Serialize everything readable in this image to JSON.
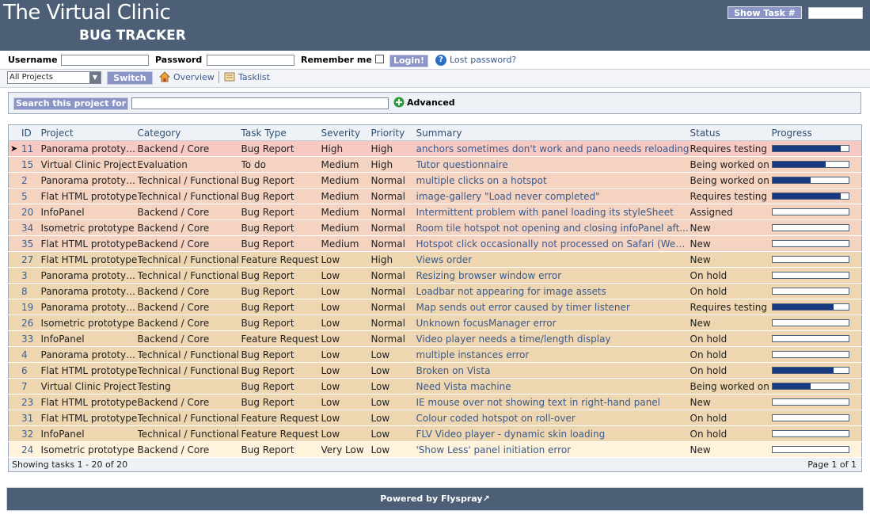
{
  "header": {
    "title": "The Virtual Clinic",
    "subtitle": "BUG TRACKER",
    "show_task_label": "Show Task #"
  },
  "login": {
    "username_label": "Username",
    "password_label": "Password",
    "remember_label": "Remember me",
    "login_button": "Login!",
    "lost_password": "Lost password?"
  },
  "nav": {
    "project_selected": "All Projects",
    "switch_button": "Switch",
    "overview": "Overview",
    "tasklist": "Tasklist"
  },
  "search": {
    "button": "Search this project for",
    "advanced": "Advanced"
  },
  "table": {
    "columns": [
      "ID",
      "Project",
      "Category",
      "Task Type",
      "Severity",
      "Priority",
      "Summary",
      "Status",
      "Progress"
    ],
    "rows": [
      {
        "id": "11",
        "project": "Panorama prototype",
        "category": "Backend / Core",
        "type": "Bug Report",
        "severity": "High",
        "priority": "High",
        "summary": "anchors sometimes don't work and pano needs reloading",
        "status": "Requires testing",
        "progress": 0.9,
        "sev_class": "high",
        "selected": true
      },
      {
        "id": "15",
        "project": "Virtual Clinic Project",
        "category": "Evaluation",
        "type": "To do",
        "severity": "Medium",
        "priority": "High",
        "summary": "Tutor questionnaire",
        "status": "Being worked on",
        "progress": 0.7,
        "sev_class": "medium"
      },
      {
        "id": "2",
        "project": "Panorama prototype",
        "category": "Technical / Functional",
        "type": "Bug Report",
        "severity": "Medium",
        "priority": "Normal",
        "summary": "multiple clicks on a hotspot",
        "status": "Being worked on",
        "progress": 0.5,
        "sev_class": "medium"
      },
      {
        "id": "5",
        "project": "Flat HTML prototype",
        "category": "Technical / Functional",
        "type": "Bug Report",
        "severity": "Medium",
        "priority": "Normal",
        "summary": "image-gallery \"Load never completed\"",
        "status": "Requires testing",
        "progress": 0.9,
        "sev_class": "medium"
      },
      {
        "id": "20",
        "project": "InfoPanel",
        "category": "Backend / Core",
        "type": "Bug Report",
        "severity": "Medium",
        "priority": "Normal",
        "summary": "Intermittent problem with panel loading its styleSheet",
        "status": "Assigned",
        "progress": 0,
        "sev_class": "medium"
      },
      {
        "id": "34",
        "project": "Isometric prototype",
        "category": "Backend / Core",
        "type": "Bug Report",
        "severity": "Medium",
        "priority": "Normal",
        "summary": "Room tile hotspot not opening and closing infoPanel aft...",
        "status": "New",
        "progress": 0,
        "sev_class": "medium"
      },
      {
        "id": "35",
        "project": "Flat HTML prototype",
        "category": "Backend / Core",
        "type": "Bug Report",
        "severity": "Medium",
        "priority": "Normal",
        "summary": "Hotspot click occasionally not processed on Safari (Web...",
        "status": "New",
        "progress": 0,
        "sev_class": "medium"
      },
      {
        "id": "27",
        "project": "Flat HTML prototype",
        "category": "Technical / Functional",
        "type": "Feature Request",
        "severity": "Low",
        "priority": "High",
        "summary": "Views order",
        "status": "New",
        "progress": 0,
        "sev_class": "low"
      },
      {
        "id": "3",
        "project": "Panorama prototype",
        "category": "Technical / Functional",
        "type": "Bug Report",
        "severity": "Low",
        "priority": "Normal",
        "summary": "Resizing browser window error",
        "status": "On hold",
        "progress": 0,
        "sev_class": "low"
      },
      {
        "id": "8",
        "project": "Panorama prototype",
        "category": "Backend / Core",
        "type": "Bug Report",
        "severity": "Low",
        "priority": "Normal",
        "summary": "Loadbar not appearing for image assets",
        "status": "On hold",
        "progress": 0,
        "sev_class": "low"
      },
      {
        "id": "19",
        "project": "Panorama prototype",
        "category": "Backend / Core",
        "type": "Bug Report",
        "severity": "Low",
        "priority": "Normal",
        "summary": "Map sends out error caused by timer listener",
        "status": "Requires testing",
        "progress": 0.8,
        "sev_class": "low"
      },
      {
        "id": "26",
        "project": "Isometric prototype",
        "category": "Backend / Core",
        "type": "Bug Report",
        "severity": "Low",
        "priority": "Normal",
        "summary": "Unknown focusManager error",
        "status": "New",
        "progress": 0,
        "sev_class": "low"
      },
      {
        "id": "33",
        "project": "InfoPanel",
        "category": "Backend / Core",
        "type": "Feature Request",
        "severity": "Low",
        "priority": "Normal",
        "summary": "Video player needs a time/length display",
        "status": "On hold",
        "progress": 0,
        "sev_class": "low"
      },
      {
        "id": "4",
        "project": "Panorama prototype",
        "category": "Technical / Functional",
        "type": "Bug Report",
        "severity": "Low",
        "priority": "Low",
        "summary": "multiple instances error",
        "status": "On hold",
        "progress": 0,
        "sev_class": "low"
      },
      {
        "id": "6",
        "project": "Flat HTML prototype",
        "category": "Technical / Functional",
        "type": "Bug Report",
        "severity": "Low",
        "priority": "Low",
        "summary": "Broken on Vista",
        "status": "On hold",
        "progress": 0.8,
        "sev_class": "low"
      },
      {
        "id": "7",
        "project": "Virtual Clinic Project",
        "category": "Testing",
        "type": "Bug Report",
        "severity": "Low",
        "priority": "Low",
        "summary": "Need Vista machine",
        "status": "Being worked on",
        "progress": 0.5,
        "sev_class": "low"
      },
      {
        "id": "23",
        "project": "Flat HTML prototype",
        "category": "Backend / Core",
        "type": "Bug Report",
        "severity": "Low",
        "priority": "Low",
        "summary": "IE mouse over not showing text in right-hand panel",
        "status": "New",
        "progress": 0,
        "sev_class": "low"
      },
      {
        "id": "31",
        "project": "Flat HTML prototype",
        "category": "Technical / Functional",
        "type": "Feature Request",
        "severity": "Low",
        "priority": "Low",
        "summary": "Colour coded hotspot on roll-over",
        "status": "On hold",
        "progress": 0,
        "sev_class": "low"
      },
      {
        "id": "32",
        "project": "InfoPanel",
        "category": "Technical / Functional",
        "type": "Feature Request",
        "severity": "Low",
        "priority": "Low",
        "summary": "FLV Video player - dynamic skin loading",
        "status": "On hold",
        "progress": 0,
        "sev_class": "low"
      },
      {
        "id": "24",
        "project": "Isometric prototype",
        "category": "Backend / Core",
        "type": "Bug Report",
        "severity": "Very Low",
        "priority": "Low",
        "summary": "'Show Less' panel initiation error",
        "status": "New",
        "progress": 0,
        "sev_class": "verylow"
      }
    ],
    "showing": "Showing tasks 1 - 20 of 20",
    "page": "Page 1 of 1"
  },
  "footer": {
    "powered": "Powered by Flyspray"
  },
  "colors": {
    "header_bg": "#4d5f76",
    "button_bg": "#8a95c6",
    "sev_high": "#f8c9c3",
    "sev_medium": "#f5d3c1",
    "sev_low": "#eed6b0",
    "sev_verylow": "#fff3dc",
    "progress_fill": "#1a3a80"
  },
  "icons": {
    "overview": "house-icon",
    "tasklist": "tasklist-icon",
    "help": "help-icon",
    "advanced": "plus-icon",
    "selected_row": "arrow-right-icon",
    "external": "external-link-icon"
  }
}
